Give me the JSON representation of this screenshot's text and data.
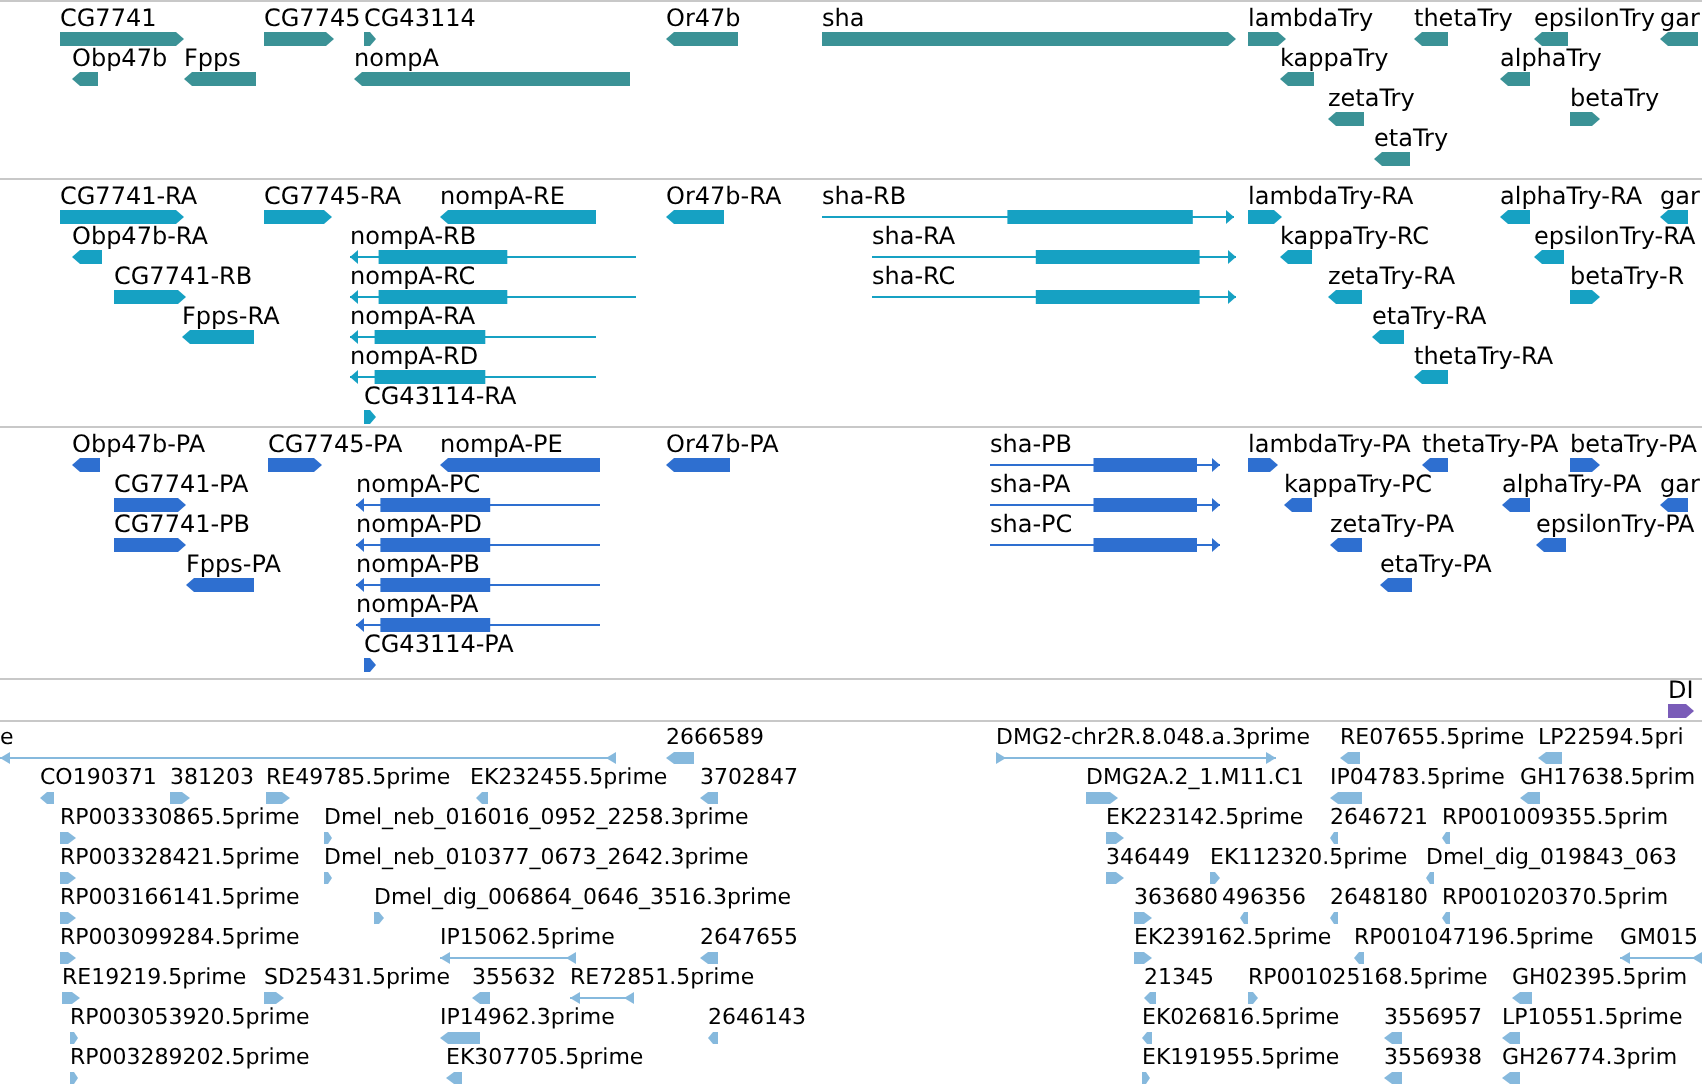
{
  "tracks": [
    {
      "color": "#3b9296",
      "features": [
        {
          "label": "CG7741",
          "reverse": false
        },
        {
          "label": "CG7745",
          "reverse": false
        },
        {
          "label": "CG43114",
          "reverse": false
        },
        {
          "label": "Or47b",
          "reverse": true
        },
        {
          "label": "sha",
          "reverse": false
        },
        {
          "label": "lambdaTry",
          "reverse": false
        },
        {
          "label": "thetaTry",
          "reverse": true
        },
        {
          "label": "epsilonTry",
          "reverse": true
        },
        {
          "label": "gar",
          "reverse": true
        },
        {
          "label": "Obp47b",
          "reverse": true
        },
        {
          "label": "Fpps",
          "reverse": true
        },
        {
          "label": "nompA",
          "reverse": true
        },
        {
          "label": "kappaTry",
          "reverse": true
        },
        {
          "label": "alphaTry",
          "reverse": true
        },
        {
          "label": "zetaTry",
          "reverse": true
        },
        {
          "label": "betaTry",
          "reverse": false
        },
        {
          "label": "etaTry",
          "reverse": true
        }
      ]
    },
    {
      "color": "#16a1c3",
      "features": [
        {
          "label": "CG7741-RA",
          "reverse": false
        },
        {
          "label": "CG7745-RA",
          "reverse": false
        },
        {
          "label": "nompA-RE",
          "reverse": true
        },
        {
          "label": "Or47b-RA",
          "reverse": true
        },
        {
          "label": "sha-RB",
          "reverse": false
        },
        {
          "label": "lambdaTry-RA",
          "reverse": false
        },
        {
          "label": "alphaTry-RA",
          "reverse": true
        },
        {
          "label": "gar",
          "reverse": true
        },
        {
          "label": "Obp47b-RA",
          "reverse": true
        },
        {
          "label": "nompA-RB",
          "reverse": true
        },
        {
          "label": "sha-RA",
          "reverse": false
        },
        {
          "label": "kappaTry-RC",
          "reverse": true
        },
        {
          "label": "epsilonTry-RA",
          "reverse": true
        },
        {
          "label": "CG7741-RB",
          "reverse": false
        },
        {
          "label": "nompA-RC",
          "reverse": true
        },
        {
          "label": "sha-RC",
          "reverse": false
        },
        {
          "label": "zetaTry-RA",
          "reverse": true
        },
        {
          "label": "betaTry-R",
          "reverse": false
        },
        {
          "label": "Fpps-RA",
          "reverse": true
        },
        {
          "label": "nompA-RA",
          "reverse": true
        },
        {
          "label": "etaTry-RA",
          "reverse": true
        },
        {
          "label": "nompA-RD",
          "reverse": true
        },
        {
          "label": "thetaTry-RA",
          "reverse": true
        },
        {
          "label": "CG43114-RA",
          "reverse": false
        }
      ]
    },
    {
      "color": "#2e6fd0",
      "features": [
        {
          "label": "Obp47b-PA",
          "reverse": true
        },
        {
          "label": "CG7745-PA",
          "reverse": false
        },
        {
          "label": "nompA-PE",
          "reverse": true
        },
        {
          "label": "Or47b-PA",
          "reverse": true
        },
        {
          "label": "sha-PB",
          "reverse": false
        },
        {
          "label": "lambdaTry-PA",
          "reverse": false
        },
        {
          "label": "thetaTry-PA",
          "reverse": true
        },
        {
          "label": "betaTry-PA",
          "reverse": false
        },
        {
          "label": "CG7741-PA",
          "reverse": false
        },
        {
          "label": "nompA-PC",
          "reverse": true
        },
        {
          "label": "sha-PA",
          "reverse": false
        },
        {
          "label": "kappaTry-PC",
          "reverse": true
        },
        {
          "label": "alphaTry-PA",
          "reverse": true
        },
        {
          "label": "gar",
          "reverse": true
        },
        {
          "label": "CG7741-PB",
          "reverse": false
        },
        {
          "label": "nompA-PD",
          "reverse": true
        },
        {
          "label": "sha-PC",
          "reverse": false
        },
        {
          "label": "zetaTry-PA",
          "reverse": true
        },
        {
          "label": "epsilonTry-PA",
          "reverse": true
        },
        {
          "label": "Fpps-PA",
          "reverse": true
        },
        {
          "label": "nompA-PB",
          "reverse": true
        },
        {
          "label": "etaTry-PA",
          "reverse": true
        },
        {
          "label": "nompA-PA",
          "reverse": true
        },
        {
          "label": "CG43114-PA",
          "reverse": false
        }
      ]
    },
    {
      "color": "#7a5cb8",
      "features": [
        {
          "label": "DI",
          "reverse": false
        }
      ]
    },
    {
      "color": "#86b9dd",
      "features": [
        {
          "label": "e",
          "reverse": true
        },
        {
          "label": "2666589",
          "reverse": true
        },
        {
          "label": "DMG2-chr2R.8.048.a.3prime",
          "reverse": false
        },
        {
          "label": "RE07655.5prime",
          "reverse": true
        },
        {
          "label": "LP22594.5pri",
          "reverse": true
        },
        {
          "label": "CO190371",
          "reverse": true
        },
        {
          "label": "381203",
          "reverse": false
        },
        {
          "label": "RE49785.5prime",
          "reverse": false
        },
        {
          "label": "EK232455.5prime",
          "reverse": true
        },
        {
          "label": "3702847",
          "reverse": true
        },
        {
          "label": "DMG2A.2_1.M11.C1",
          "reverse": false
        },
        {
          "label": "IP04783.5prime",
          "reverse": true
        },
        {
          "label": "GH17638.5prim",
          "reverse": true
        },
        {
          "label": "RP003330865.5prime",
          "reverse": false
        },
        {
          "label": "Dmel_neb_016016_0952_2258.3prime",
          "reverse": false
        },
        {
          "label": "EK223142.5prime",
          "reverse": false
        },
        {
          "label": "2646721",
          "reverse": true
        },
        {
          "label": "RP001009355.5prim",
          "reverse": true
        },
        {
          "label": "RP003328421.5prime",
          "reverse": false
        },
        {
          "label": "Dmel_neb_010377_0673_2642.3prime",
          "reverse": false
        },
        {
          "label": "346449",
          "reverse": false
        },
        {
          "label": "EK112320.5prime",
          "reverse": false
        },
        {
          "label": "Dmel_dig_019843_063",
          "reverse": true
        },
        {
          "label": "RP003166141.5prime",
          "reverse": false
        },
        {
          "label": "Dmel_dig_006864_0646_3516.3prime",
          "reverse": false
        },
        {
          "label": "363680",
          "reverse": false
        },
        {
          "label": "496356",
          "reverse": true
        },
        {
          "label": "2648180",
          "reverse": true
        },
        {
          "label": "RP001020370.5prim",
          "reverse": true
        },
        {
          "label": "RP003099284.5prime",
          "reverse": false
        },
        {
          "label": "IP15062.5prime",
          "reverse": true
        },
        {
          "label": "2647655",
          "reverse": true
        },
        {
          "label": "EK239162.5prime",
          "reverse": false
        },
        {
          "label": "RP001047196.5prime",
          "reverse": true
        },
        {
          "label": "GM015",
          "reverse": true
        },
        {
          "label": "RE19219.5prime",
          "reverse": false
        },
        {
          "label": "SD25431.5prime",
          "reverse": false
        },
        {
          "label": "355632",
          "reverse": true
        },
        {
          "label": "RE72851.5prime",
          "reverse": true
        },
        {
          "label": "21345",
          "reverse": true
        },
        {
          "label": "RP001025168.5prime",
          "reverse": false
        },
        {
          "label": "GH02395.5prim",
          "reverse": true
        },
        {
          "label": "RP003053920.5prime",
          "reverse": false
        },
        {
          "label": "IP14962.3prime",
          "reverse": true
        },
        {
          "label": "2646143",
          "reverse": true
        },
        {
          "label": "EK026816.5prime",
          "reverse": true
        },
        {
          "label": "3556957",
          "reverse": true
        },
        {
          "label": "LP10551.5prime",
          "reverse": true
        },
        {
          "label": "RP003289202.5prime",
          "reverse": false
        },
        {
          "label": "EK307705.5prime",
          "reverse": true
        },
        {
          "label": "EK191955.5prime",
          "reverse": false
        },
        {
          "label": "3556938",
          "reverse": true
        },
        {
          "label": "GH26774.3prim",
          "reverse": true
        }
      ]
    }
  ]
}
